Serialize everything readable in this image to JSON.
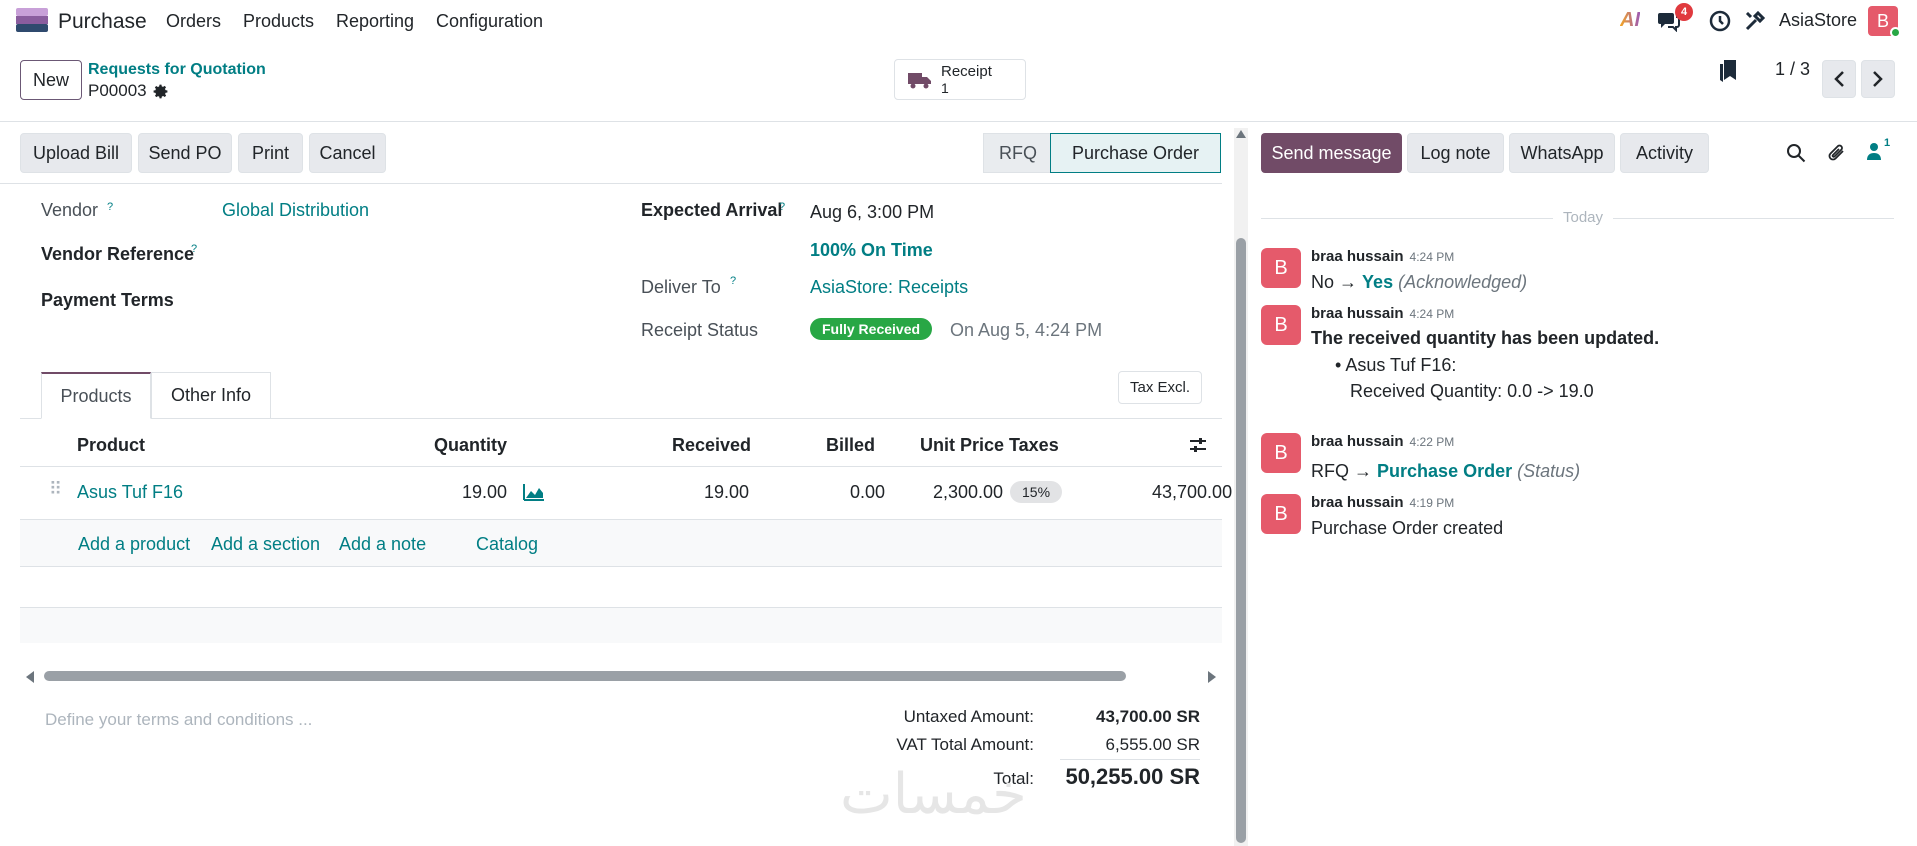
{
  "navbar": {
    "app_name": "Purchase",
    "menu": [
      "Orders",
      "Products",
      "Reporting",
      "Configuration"
    ],
    "ai_label": "AI",
    "messages_count": "4",
    "company": "AsiaStore",
    "user_initial": "B"
  },
  "control": {
    "new_label": "New",
    "breadcrumb_parent": "Requests for Quotation",
    "record_name": "P00003",
    "smart_button_label": "Receipt",
    "smart_button_count": "1",
    "pager": "1 / 3"
  },
  "actions": {
    "upload_bill": "Upload Bill",
    "send_po": "Send PO",
    "print": "Print",
    "cancel": "Cancel"
  },
  "statusbar": {
    "stages": [
      "RFQ",
      "Purchase Order"
    ],
    "active": "Purchase Order"
  },
  "form": {
    "vendor_label": "Vendor",
    "vendor_value": "Global Distribution",
    "vendor_ref_label": "Vendor Reference",
    "payment_terms_label": "Payment Terms",
    "expected_arrival_label": "Expected Arrival",
    "expected_arrival_value": "Aug 6, 3:00 PM",
    "on_time": "100% On Time",
    "deliver_to_label": "Deliver To",
    "deliver_to_value": "AsiaStore: Receipts",
    "receipt_status_label": "Receipt Status",
    "receipt_status_badge": "Fully Received",
    "receipt_status_date": "On Aug 5, 4:24 PM",
    "help_mark": "?"
  },
  "tabs": {
    "products": "Products",
    "other_info": "Other Info",
    "tax_excl": "Tax Excl."
  },
  "lines": {
    "headers": {
      "product": "Product",
      "quantity": "Quantity",
      "received": "Received",
      "billed": "Billed",
      "unit_price": "Unit Price",
      "taxes": "Taxes"
    },
    "rows": [
      {
        "product": "Asus Tuf F16",
        "quantity": "19.00",
        "received": "19.00",
        "billed": "0.00",
        "unit_price": "2,300.00",
        "taxes": "15%",
        "subtotal": "43,700.00"
      }
    ],
    "add_product": "Add a product",
    "add_section": "Add a section",
    "add_note": "Add a note",
    "catalog": "Catalog"
  },
  "footer": {
    "terms_placeholder": "Define your terms and conditions ...",
    "untaxed_label": "Untaxed Amount:",
    "untaxed_value": "43,700.00 SR",
    "vat_label": "VAT Total Amount:",
    "vat_value": "6,555.00 SR",
    "total_label": "Total:",
    "total_value": "50,255.00 SR",
    "watermark": "خمسات"
  },
  "chatter": {
    "send_message": "Send message",
    "log_note": "Log note",
    "whatsapp": "WhatsApp",
    "activity": "Activity",
    "followers_count": "1",
    "today": "Today",
    "messages": [
      {
        "author": "braa hussain",
        "time": "4:24 PM",
        "from": "No",
        "arrow": "→",
        "to": "Yes",
        "field": "(Acknowledged)"
      },
      {
        "author": "braa hussain",
        "time": "4:24 PM",
        "title": "The received quantity has been updated.",
        "bullet": "Asus Tuf F16:",
        "detail": "Received Quantity: 0.0 -> 19.0"
      },
      {
        "author": "braa hussain",
        "time": "4:22 PM",
        "from": "RFQ",
        "arrow": "→",
        "to": "Purchase Order",
        "field": "(Status)"
      },
      {
        "author": "braa hussain",
        "time": "4:19 PM",
        "body": "Purchase Order created"
      }
    ],
    "avatar_initial": "B"
  },
  "colors": {
    "primary": "#714b67",
    "link": "#017e84",
    "success": "#28a745",
    "avatar": "#e55a6b"
  }
}
